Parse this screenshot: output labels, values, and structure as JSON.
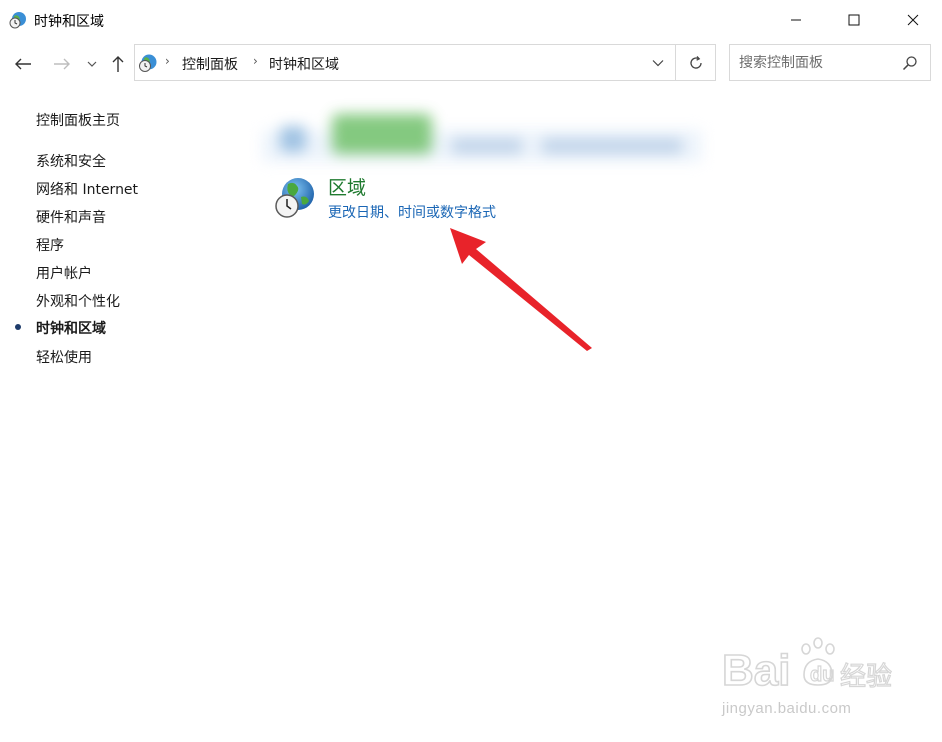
{
  "window": {
    "title": "时钟和区域",
    "minimize_icon": "minimize-icon",
    "maximize_icon": "maximize-icon",
    "close_icon": "close-icon"
  },
  "navigation": {
    "back_icon": "arrow-left-icon",
    "forward_icon": "arrow-right-icon",
    "recent_icon": "chevron-down-icon",
    "up_icon": "arrow-up-icon"
  },
  "address_bar": {
    "breadcrumbs": [
      "控制面板",
      "时钟和区域"
    ],
    "separator": "›",
    "dropdown_icon": "chevron-down-icon",
    "refresh_icon": "refresh-icon"
  },
  "search": {
    "placeholder": "搜索控制面板",
    "icon": "search-icon"
  },
  "sidebar": {
    "home": "控制面板主页",
    "items": [
      {
        "label": "系统和安全",
        "active": false
      },
      {
        "label": "网络和 Internet",
        "active": false
      },
      {
        "label": "硬件和声音",
        "active": false
      },
      {
        "label": "程序",
        "active": false
      },
      {
        "label": "用户帐户",
        "active": false
      },
      {
        "label": "外观和个性化",
        "active": false
      },
      {
        "label": "时钟和区域",
        "active": true
      },
      {
        "label": "轻松使用",
        "active": false
      }
    ]
  },
  "main": {
    "categories": [
      {
        "title": "区域",
        "icon": "globe-clock-icon",
        "links": [
          "更改日期、时间或数字格式"
        ]
      }
    ]
  },
  "annotation": {
    "arrow_color": "#e8232a"
  },
  "watermark": {
    "brand": "Baidu经验",
    "url": "jingyan.baidu.com"
  },
  "colors": {
    "category_title": "#1f7a2f",
    "link": "#1a66b5",
    "active_bullet": "#1e3b6b"
  }
}
